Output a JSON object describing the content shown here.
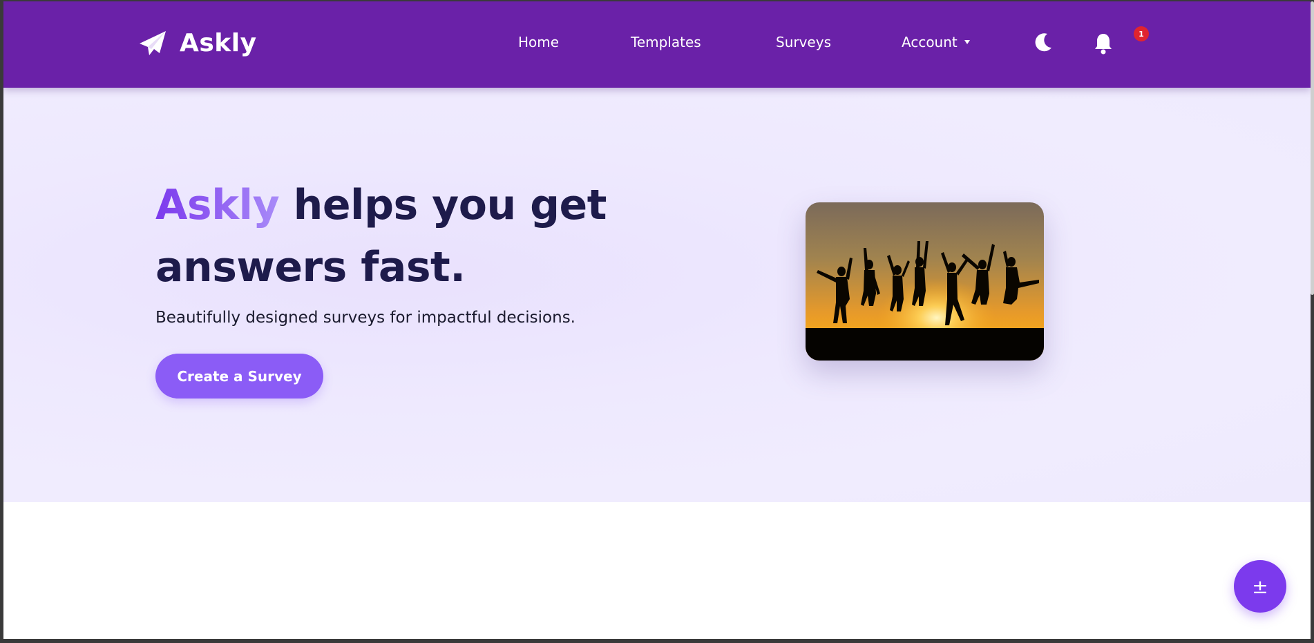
{
  "brand": {
    "name": "Askly",
    "icon": "paper-plane-icon"
  },
  "nav": {
    "home": "Home",
    "templates": "Templates",
    "surveys": "Surveys",
    "account": "Account",
    "theme_icon": "moon-icon",
    "notifications_icon": "bell-icon",
    "notification_count": "1"
  },
  "hero": {
    "title_accent": "Askly",
    "title_rest": " helps you get answers fast.",
    "subtitle": "Beautifully designed surveys for impactful decisions.",
    "cta_label": "Create a Survey",
    "image_alt": "People jumping at sunset"
  },
  "fab": {
    "label": "±"
  },
  "colors": {
    "navbar": "#6a21a8",
    "accent": "#8b5cf6",
    "fab": "#7c3aed",
    "badge": "#e0242f",
    "title": "#1e1b4b"
  }
}
